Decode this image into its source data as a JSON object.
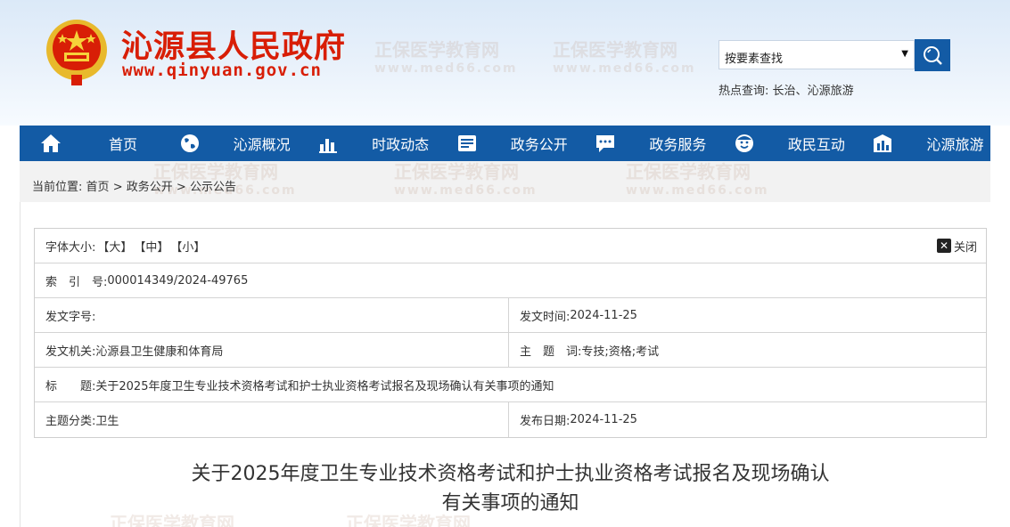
{
  "header": {
    "site_title": "沁源县人民政府",
    "site_url": "www.qinyuan.gov.cn",
    "watermark_cn": "正保医学教育网",
    "watermark_url": "www.med66.com",
    "search": {
      "placeholder": "按要素查找"
    },
    "hot_label": "热点查询:",
    "hot_links": [
      "长治",
      "沁源旅游"
    ],
    "hot_sep": "、"
  },
  "nav": {
    "items": [
      {
        "label": "首页",
        "icon": "home-icon"
      },
      {
        "label": "沁源概况",
        "icon": "globe-icon"
      },
      {
        "label": "时政动态",
        "icon": "chart-icon"
      },
      {
        "label": "政务公开",
        "icon": "document-icon"
      },
      {
        "label": "政务服务",
        "icon": "chat-icon"
      },
      {
        "label": "政民互动",
        "icon": "user-icon"
      },
      {
        "label": "沁源旅游",
        "icon": "building-icon"
      }
    ]
  },
  "breadcrumb": {
    "prefix": "当前位置:",
    "items": [
      "首页",
      "政务公开",
      "公示公告"
    ],
    "sep": ">"
  },
  "info": {
    "font_size_label": "字体大小:",
    "font_sizes": [
      "【大】",
      "【中】",
      "【小】"
    ],
    "close_label": "关闭",
    "index_label": "索　引　号:",
    "index_value": "000014349/2024-49765",
    "doc_no_label": "发文字号:",
    "doc_no_value": "",
    "issue_time_label": "发文时间:",
    "issue_time_value": "2024-11-25",
    "issuer_label": "发文机关:",
    "issuer_value": "沁源县卫生健康和体育局",
    "keywords_label": "主　题　词:",
    "keywords_value": "专技;资格;考试",
    "title_label": "标　　题:",
    "title_value": "关于2025年度卫生专业技术资格考试和护士执业资格考试报名及现场确认有关事项的通知",
    "category_label": "主题分类:",
    "category_value": "卫生",
    "publish_label": "发布日期:",
    "publish_value": "2024-11-25"
  },
  "document": {
    "title_line1": "关于2025年度卫生专业技术资格考试和护士执业资格考试报名及现场确认",
    "title_line2": "有关事项的通知"
  },
  "colors": {
    "brand_red": "#d81e06",
    "nav_blue": "#135ba5"
  }
}
